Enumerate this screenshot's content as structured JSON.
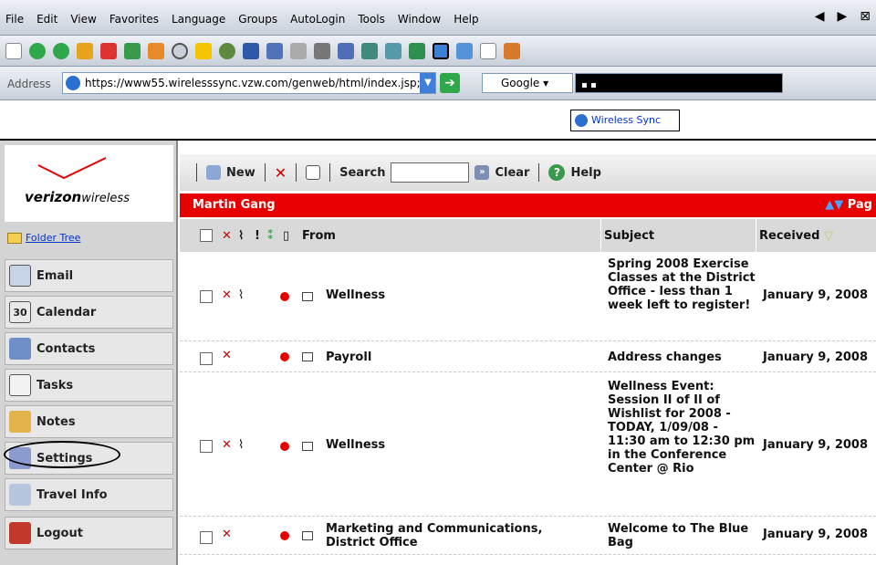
{
  "menubar": {
    "items": [
      "File",
      "Edit",
      "View",
      "Favorites",
      "Language",
      "Groups",
      "AutoLogin",
      "Tools",
      "Window",
      "Help"
    ],
    "nav_glyphs": [
      "◀",
      "▶",
      "⊠"
    ]
  },
  "address": {
    "label": "Address",
    "url": "https://www55.wirelesssync.vzw.com/genweb/html/index.jsp;",
    "search_engine": "Google",
    "search_value": "▪ ▪"
  },
  "tab": {
    "title": "Wireless Sync"
  },
  "sidebar": {
    "logo_brand": "verizon",
    "logo_suffix": "wireless",
    "folder_tree": "Folder Tree",
    "items": [
      {
        "label": "Email"
      },
      {
        "label": "Calendar"
      },
      {
        "label": "Contacts"
      },
      {
        "label": "Tasks"
      },
      {
        "label": "Notes"
      },
      {
        "label": "Settings"
      },
      {
        "label": "Travel Info"
      },
      {
        "label": "Logout"
      }
    ]
  },
  "actions": {
    "new": "New",
    "search": "Search",
    "clear": "Clear",
    "help": "Help"
  },
  "account": {
    "name": "Martin Gang",
    "pager": "Pag"
  },
  "columns": {
    "from": "From",
    "subject": "Subject",
    "received": "Received"
  },
  "messages": [
    {
      "from": "Wellness",
      "subject": "Spring 2008 Exercise Classes at the District Office - less than 1 week left to register!",
      "received": "January 9, 2008",
      "attachment": true
    },
    {
      "from": "Payroll",
      "subject": "Address changes",
      "received": "January 9, 2008",
      "attachment": false
    },
    {
      "from": "Wellness",
      "subject": "Wellness Event: Session II of II of Wishlist for 2008 - TODAY, 1/09/08 - 11:30 am to 12:30 pm in the Conference Center @ Rio",
      "received": "January 9, 2008",
      "attachment": true
    },
    {
      "from": "Marketing and Communications, District Office",
      "subject": "Welcome to The Blue Bag",
      "received": "January 9, 2008",
      "attachment": false
    }
  ],
  "colors": {
    "brand_red": "#e60000",
    "link_blue": "#0033cc"
  }
}
